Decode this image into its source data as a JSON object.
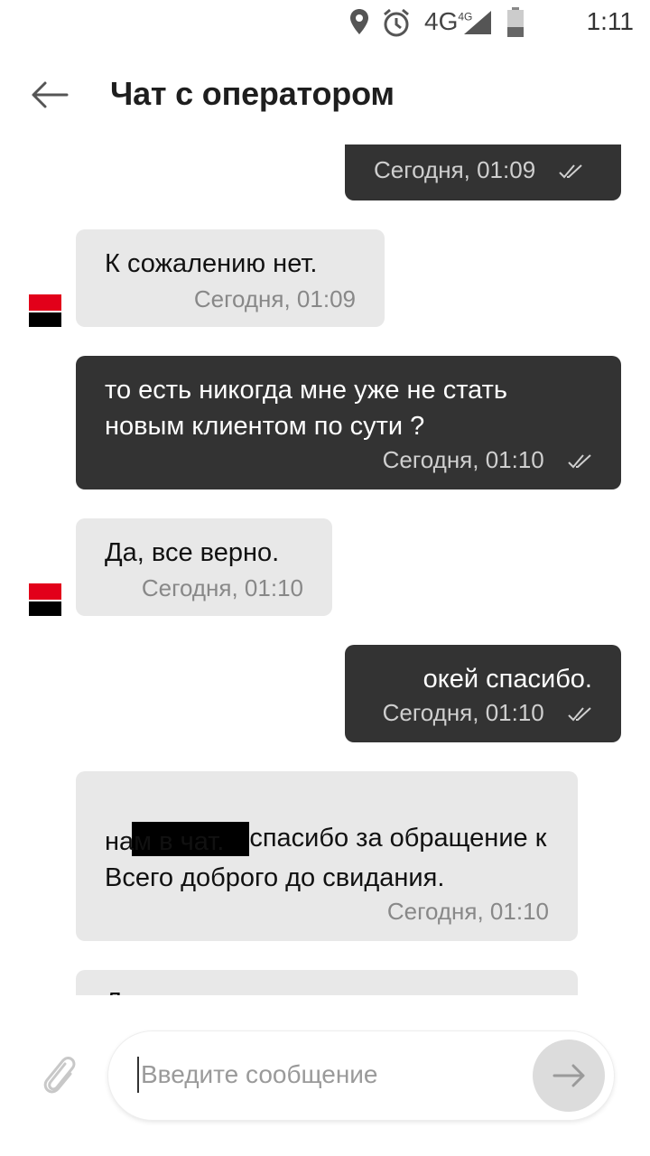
{
  "status_bar": {
    "network": "4G",
    "network_sup": "4G",
    "time": "1:11"
  },
  "header": {
    "title": "Чат с оператором"
  },
  "messages": [
    {
      "type": "out",
      "text": "",
      "time": "Сегодня, 01:09"
    },
    {
      "type": "in",
      "text": "К сожалению нет.",
      "time": "Сегодня, 01:09"
    },
    {
      "type": "out",
      "text": "то есть никогда мне уже не стать\nновым клиентом по сути ?",
      "time": "Сегодня, 01:10"
    },
    {
      "type": "in",
      "text": "Да, все верно.",
      "time": "Сегодня, 01:10"
    },
    {
      "type": "out",
      "text": "окей спасибо.",
      "time": "Сегодня, 01:10"
    },
    {
      "type": "in",
      "text_first": "спасибо за обращение к",
      "text_rest": "нам в чат.\nВсего доброго до свидания.",
      "time": "Сегодня, 01:10"
    },
    {
      "type": "in",
      "text": "Д",
      "time": ""
    }
  ],
  "input": {
    "placeholder": "Введите сообщение"
  },
  "colors": {
    "outgoing_bubble": "#333333",
    "incoming_bubble": "#e8e8e8",
    "brand_red": "#e2001a"
  },
  "icons": [
    "location-icon",
    "alarm-icon",
    "signal-icon",
    "battery-icon",
    "back-arrow-icon",
    "read-checks-icon",
    "bank-logo-icon",
    "attach-icon",
    "send-arrow-icon"
  ]
}
